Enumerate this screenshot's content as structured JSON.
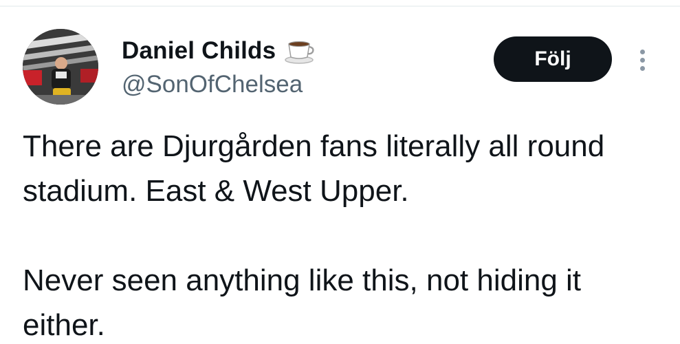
{
  "author": {
    "display_name": "Daniel Childs",
    "handle": "@SonOfChelsea",
    "name_emoji": "coffee-cup-icon"
  },
  "actions": {
    "follow_label": "Följ",
    "more_icon": "more-vertical-icon"
  },
  "tweet": {
    "paragraphs": [
      "There are Djurgården fans literally all round stadium. East & West Upper.",
      "Never seen anything like this, not hiding it either."
    ]
  },
  "colors": {
    "follow_bg": "#0f1419",
    "handle": "#536471",
    "text": "#0f1419"
  }
}
